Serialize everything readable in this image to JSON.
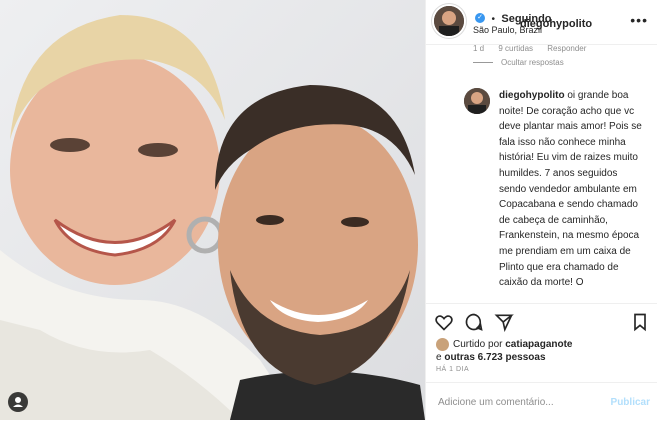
{
  "post": {
    "author": "diegohypolito",
    "follow_label": "Seguindo",
    "location": "São Paulo, Brazil",
    "more_icon": "more-horizontal-icon"
  },
  "prev_comment_meta": {
    "time": "1 d",
    "likes": "9 curtidas",
    "reply": "Responder",
    "hide": "Ocultar respostas"
  },
  "comment": {
    "author": "diegohypolito",
    "text": "oi grande boa noite! De coração acho que vc deve plantar mais amor! Pois se fala isso não conhece minha história! Eu vim de raizes muito humildes. 7 anos seguidos sendo vendedor ambulante em Copacabana e sendo chamado de cabeça de caminhão, Frankenstein, na mesmo época me prendiam em um caixa de Plinto que era chamado de caixão da morte! O"
  },
  "likes": {
    "prefix": "Curtido por",
    "user": "catiapaganote",
    "and": "e",
    "others": "outras 6.723 pessoas"
  },
  "timestamp": "HÁ 1 DIA",
  "add_comment": {
    "placeholder": "Adicione um comentário...",
    "publish": "Publicar"
  },
  "colors": {
    "verified": "#3897f0",
    "publish_disabled": "#b2dffc",
    "muted": "#8e8e8e"
  }
}
